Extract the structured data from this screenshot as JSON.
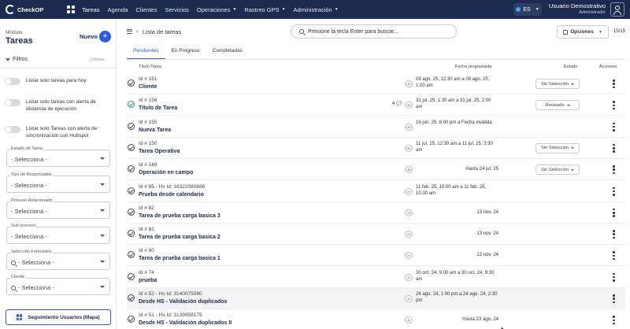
{
  "app": {
    "brand": "CheckOP"
  },
  "topnav": {
    "items": [
      {
        "label": "Tareas",
        "has_caret": false
      },
      {
        "label": "Agenda",
        "has_caret": false
      },
      {
        "label": "Clientes",
        "has_caret": false
      },
      {
        "label": "Servicios",
        "has_caret": false
      },
      {
        "label": "Operaciones",
        "has_caret": true
      },
      {
        "label": "Rastreo GPS",
        "has_caret": true
      },
      {
        "label": "Administración",
        "has_caret": true
      }
    ],
    "active_item": "Tareas",
    "language": "ES",
    "user_name": "Usuario Demostrativo",
    "user_role": "Administrador"
  },
  "sidebar": {
    "module_label": "Módulo",
    "module_title": "Tareas",
    "new_label": "Nuevo",
    "filters_label": "Filtros",
    "clear_label": "Limpiar",
    "toggles": [
      {
        "label": "Listar solo tareas para hoy",
        "on": false
      },
      {
        "label": "Listar solo tareas con alerta de distancia de ejecución",
        "on": false
      },
      {
        "label": "Listar solo Tareas con alerta de sincronización con Hubspot",
        "on": false
      }
    ],
    "fields": [
      {
        "label": "Estado de Tarea",
        "value": "- Selecciona -",
        "search": false
      },
      {
        "label": "Tipo de Responsable",
        "value": "- Selecciona -",
        "search": false
      },
      {
        "label": "Proceso Relacionado",
        "value": "- Selecciona -",
        "search": false
      },
      {
        "label": "Sub proceso",
        "value": "- Selecciona -",
        "search": false
      },
      {
        "label": "Selección Formulario",
        "value": "- Selecciona -",
        "search": true
      },
      {
        "label": "Cliente",
        "value": "- Selecciona -",
        "search": true
      }
    ],
    "map_button_label": "Seguimiento Usuarios (Mapa)"
  },
  "main": {
    "breadcrumb_separator": "›",
    "page_title": "Lista de tareas",
    "search_placeholder": "Presione la tecla Enter para buscar...",
    "options_label": "Opciones",
    "counter": "15/15",
    "tabs": [
      "Pendientes",
      "En Progreso",
      "Completadas"
    ],
    "active_tab": "Pendientes",
    "columns": {
      "title": "Título Tarea",
      "date": "Fecha programada",
      "status": "Estado",
      "actions": "Acciones"
    },
    "rows": [
      {
        "id": "Id # 161",
        "name": "Cliente",
        "badge": "UD",
        "comments": "",
        "date": "08 ago. 25, 12:30 am a 08 ago. 25, 1:00 am",
        "status": "Sin Selección",
        "done": false,
        "shade": false
      },
      {
        "id": "Id # 156",
        "name": "Título de Tarea",
        "badge": "UD",
        "comments": "4 💬",
        "date": "31 jul. 25, 1:30 am a 31 jul. 25, 2:00 am",
        "status": "Revisado",
        "done": true,
        "shade": false
      },
      {
        "id": "Id # 155",
        "name": "Nueva Tarea",
        "badge": "UD",
        "comments": "",
        "date": "16 jun. 25, 8:00 pm a Fecha inválida",
        "status": "",
        "done": false,
        "shade": false
      },
      {
        "id": "Id # 150",
        "name": "Tarea Operativa",
        "badge": "UD",
        "comments": "",
        "date": "11 jul. 25, 12:30 am a 11 jul. 25, 3:30 am",
        "status": "Sin Selección",
        "done": false,
        "shade": false
      },
      {
        "id": "Id # 149",
        "name": "Operación en campo",
        "badge": "UD",
        "comments": "",
        "date": "Hasta 24 jul. 25",
        "status": "Sin Selección",
        "done": false,
        "shade": false
      },
      {
        "id": "Id # 85 - Hs Id: 16322080686",
        "name": "Prueba desde calendario",
        "badge": "JG",
        "comments": "",
        "date": "11 feb. 25, 10:00 am a 11 feb. 25, 10:30 am",
        "status": "",
        "done": false,
        "shade": false
      },
      {
        "id": "Id # 82",
        "name": "Tarea de prueba carga basica 3",
        "badge": "JG",
        "comments": "",
        "date": "13 nov. 24",
        "status": "",
        "done": false,
        "shade": false
      },
      {
        "id": "Id # 81",
        "name": "Tarea de prueba carga basica 2",
        "badge": "JG",
        "comments": "",
        "date": "13 nov. 24",
        "status": "",
        "done": false,
        "shade": false
      },
      {
        "id": "Id # 80",
        "name": "Tarea de prueba carga basica 1",
        "badge": "JG",
        "comments": "",
        "date": "13 nov. 24",
        "status": "",
        "done": false,
        "shade": false
      },
      {
        "id": "Id # 74",
        "name": "prueba",
        "badge": "JL",
        "comments": "",
        "date": "30 oct. 24, 9:00 am a 30 oct. 24, 9:30 am",
        "status": "",
        "done": false,
        "shade": false
      },
      {
        "id": "Id # 52 - Hs Id: 3140075080",
        "name": "Desde HS - Validación duplicados",
        "badge": "JL",
        "comments": "",
        "date": "24 ago. 24, 1:00 pm a 24 ago. 24, 2:30 pm",
        "status": "",
        "done": false,
        "shade": true
      },
      {
        "id": "Id # 51 - Hs Id: 3139958175",
        "name": "Desde HS - Validación duplicados II",
        "badge": "JL",
        "comments": "",
        "date": "Hasta 23 ago. 24",
        "status": "",
        "done": false,
        "shade": false
      }
    ]
  }
}
